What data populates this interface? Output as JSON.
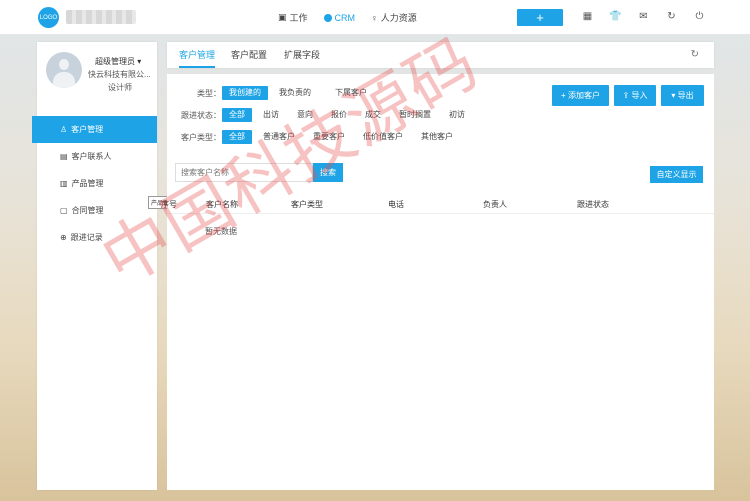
{
  "header": {
    "logo": "LOGO",
    "nav": [
      {
        "label": "工作",
        "icon": "briefcase-icon"
      },
      {
        "label": "CRM",
        "icon": "circle-icon"
      },
      {
        "label": "人力资源",
        "icon": "people-icon"
      }
    ],
    "add_label": "+",
    "icons": [
      "qrcode-icon",
      "shirt-icon",
      "mail-icon",
      "refresh-icon",
      "power-icon"
    ]
  },
  "user": {
    "name": "超级管理员 ▾",
    "company": "快云科技有限公...",
    "role": "设计师"
  },
  "sidebar": {
    "items": [
      {
        "label": "客户管理",
        "icon": "customer-icon"
      },
      {
        "label": "客户联系人",
        "icon": "contact-icon"
      },
      {
        "label": "产品管理",
        "icon": "product-icon"
      },
      {
        "label": "合同管理",
        "icon": "contract-icon"
      },
      {
        "label": "跟进记录",
        "icon": "followup-icon"
      }
    ],
    "tooltip": "产品管理"
  },
  "tabs": [
    "客户管理",
    "客户配置",
    "扩展字段"
  ],
  "filters": {
    "type": {
      "label": "类型：",
      "options": [
        "我创建的",
        "我负责的",
        "下属客户"
      ]
    },
    "status": {
      "label": "跟进状态：",
      "options": [
        "全部",
        "出访",
        "意向",
        "报价",
        "成交",
        "暂时搁置",
        "初访"
      ]
    },
    "ctype": {
      "label": "客户类型：",
      "options": [
        "全部",
        "普通客户",
        "重要客户",
        "低价值客户",
        "其他客户"
      ]
    }
  },
  "actions": {
    "add": "+ 添加客户",
    "import": "⇪ 导入",
    "export": "▾ 导出"
  },
  "search": {
    "placeholder": "搜索客户名称",
    "button": "搜索"
  },
  "custom_display": "自定义显示",
  "table": {
    "columns": [
      "序号",
      "客户名称",
      "客户类型",
      "电话",
      "负责人",
      "跟进状态"
    ],
    "empty": "暂无数据"
  },
  "watermark": "中国科技源码"
}
